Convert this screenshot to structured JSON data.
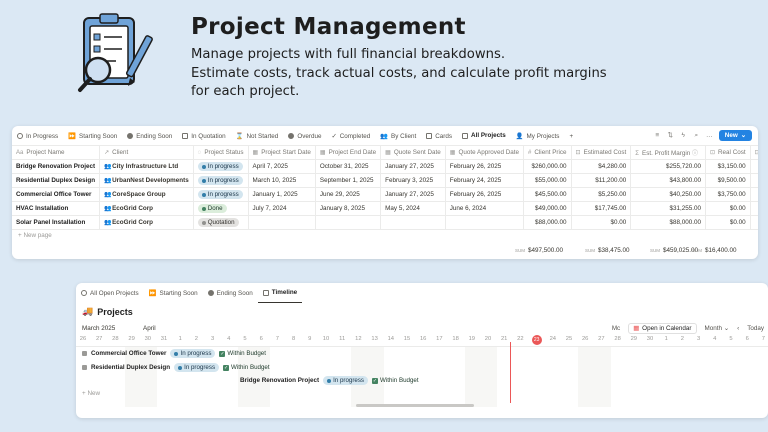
{
  "hero": {
    "title": "Project Management",
    "desc_lines": [
      "Manage projects with full financial breakdowns.",
      "Estimate costs, track actual costs, and calculate profit margins",
      "for each project."
    ]
  },
  "db": {
    "tabs": [
      "In Progress",
      "Starting Soon",
      "Ending Soon",
      "In Quotation",
      "Not Started",
      "Overdue",
      "Completed",
      "By Client",
      "Cards",
      "All Projects",
      "My Projects"
    ],
    "active_tab": "All Projects",
    "new_button": "New",
    "columns": [
      "Project Name",
      "Client",
      "Project Status",
      "Project Start Date",
      "Project End Date",
      "Quote Sent Date",
      "Quote Approved Date",
      "Client Price",
      "Estimated Cost",
      "Est. Profit Margin",
      "Real Cost",
      "Re"
    ],
    "rows": [
      {
        "name": "Bridge Renovation Project",
        "client": "City Infrastructure Ltd",
        "status": "In progress",
        "start": "April 7, 2025",
        "end": "October 31, 2025",
        "quote_sent": "January 27, 2025",
        "quote_approved": "February 26, 2025",
        "price": "$260,000.00",
        "est_cost": "$4,280.00",
        "margin": "$255,720.00",
        "real_cost": "$3,150.00"
      },
      {
        "name": "Residential Duplex Design",
        "client": "UrbanNest Developments",
        "status": "In progress",
        "start": "March 10, 2025",
        "end": "September 1, 2025",
        "quote_sent": "February 3, 2025",
        "quote_approved": "February 24, 2025",
        "price": "$55,000.00",
        "est_cost": "$11,200.00",
        "margin": "$43,800.00",
        "real_cost": "$9,500.00"
      },
      {
        "name": "Commercial Office Tower",
        "client": "CoreSpace Group",
        "status": "In progress",
        "start": "January 1, 2025",
        "end": "June 29, 2025",
        "quote_sent": "January 27, 2025",
        "quote_approved": "February 26, 2025",
        "price": "$45,500.00",
        "est_cost": "$5,250.00",
        "margin": "$40,250.00",
        "real_cost": "$3,750.00"
      },
      {
        "name": "HVAC Installation",
        "client": "EcoGrid Corp",
        "status": "Done",
        "start": "July 7, 2024",
        "end": "January 8, 2025",
        "quote_sent": "May 5, 2024",
        "quote_approved": "June 6, 2024",
        "price": "$49,000.00",
        "est_cost": "$17,745.00",
        "margin": "$31,255.00",
        "real_cost": "$0.00"
      },
      {
        "name": "Solar Panel Installation",
        "client": "EcoGrid Corp",
        "status": "Quotation",
        "start": "",
        "end": "",
        "quote_sent": "",
        "quote_approved": "",
        "price": "$88,000.00",
        "est_cost": "$0.00",
        "margin": "$88,000.00",
        "real_cost": "$0.00"
      }
    ],
    "new_page": "New page",
    "sum_label": "SUM",
    "sums": {
      "price": "$497,500.00",
      "est_cost": "$38,475.00",
      "margin": "$459,025.00",
      "real_cost": "$16,400.00"
    }
  },
  "timeline": {
    "tabs": [
      "All Open Projects",
      "Starting Soon",
      "Ending Soon",
      "Timeline"
    ],
    "active_tab": "Timeline",
    "title": "Projects",
    "months": [
      "March 2025",
      "April"
    ],
    "open_calendar": "Open in Calendar",
    "view": "Month",
    "today": "Today",
    "trunc_label": "Mc",
    "days": [
      "26",
      "27",
      "28",
      "29",
      "30",
      "31",
      "1",
      "2",
      "3",
      "4",
      "5",
      "6",
      "7",
      "8",
      "9",
      "10",
      "11",
      "12",
      "13",
      "14",
      "15",
      "16",
      "17",
      "18",
      "19",
      "20",
      "21",
      "22",
      "23",
      "24",
      "25",
      "26",
      "27",
      "28",
      "29",
      "30",
      "1",
      "2",
      "3",
      "4",
      "5",
      "6",
      "7"
    ],
    "today_day": "23",
    "rows": [
      {
        "name": "Commercial Office Tower",
        "status": "In progress",
        "budget": "Within Budget"
      },
      {
        "name": "Residential Duplex Design",
        "status": "In progress",
        "budget": "Within Budget"
      },
      {
        "name": "Bridge Renovation Project",
        "status": "In progress",
        "budget": "Within Budget"
      }
    ],
    "new": "New"
  }
}
